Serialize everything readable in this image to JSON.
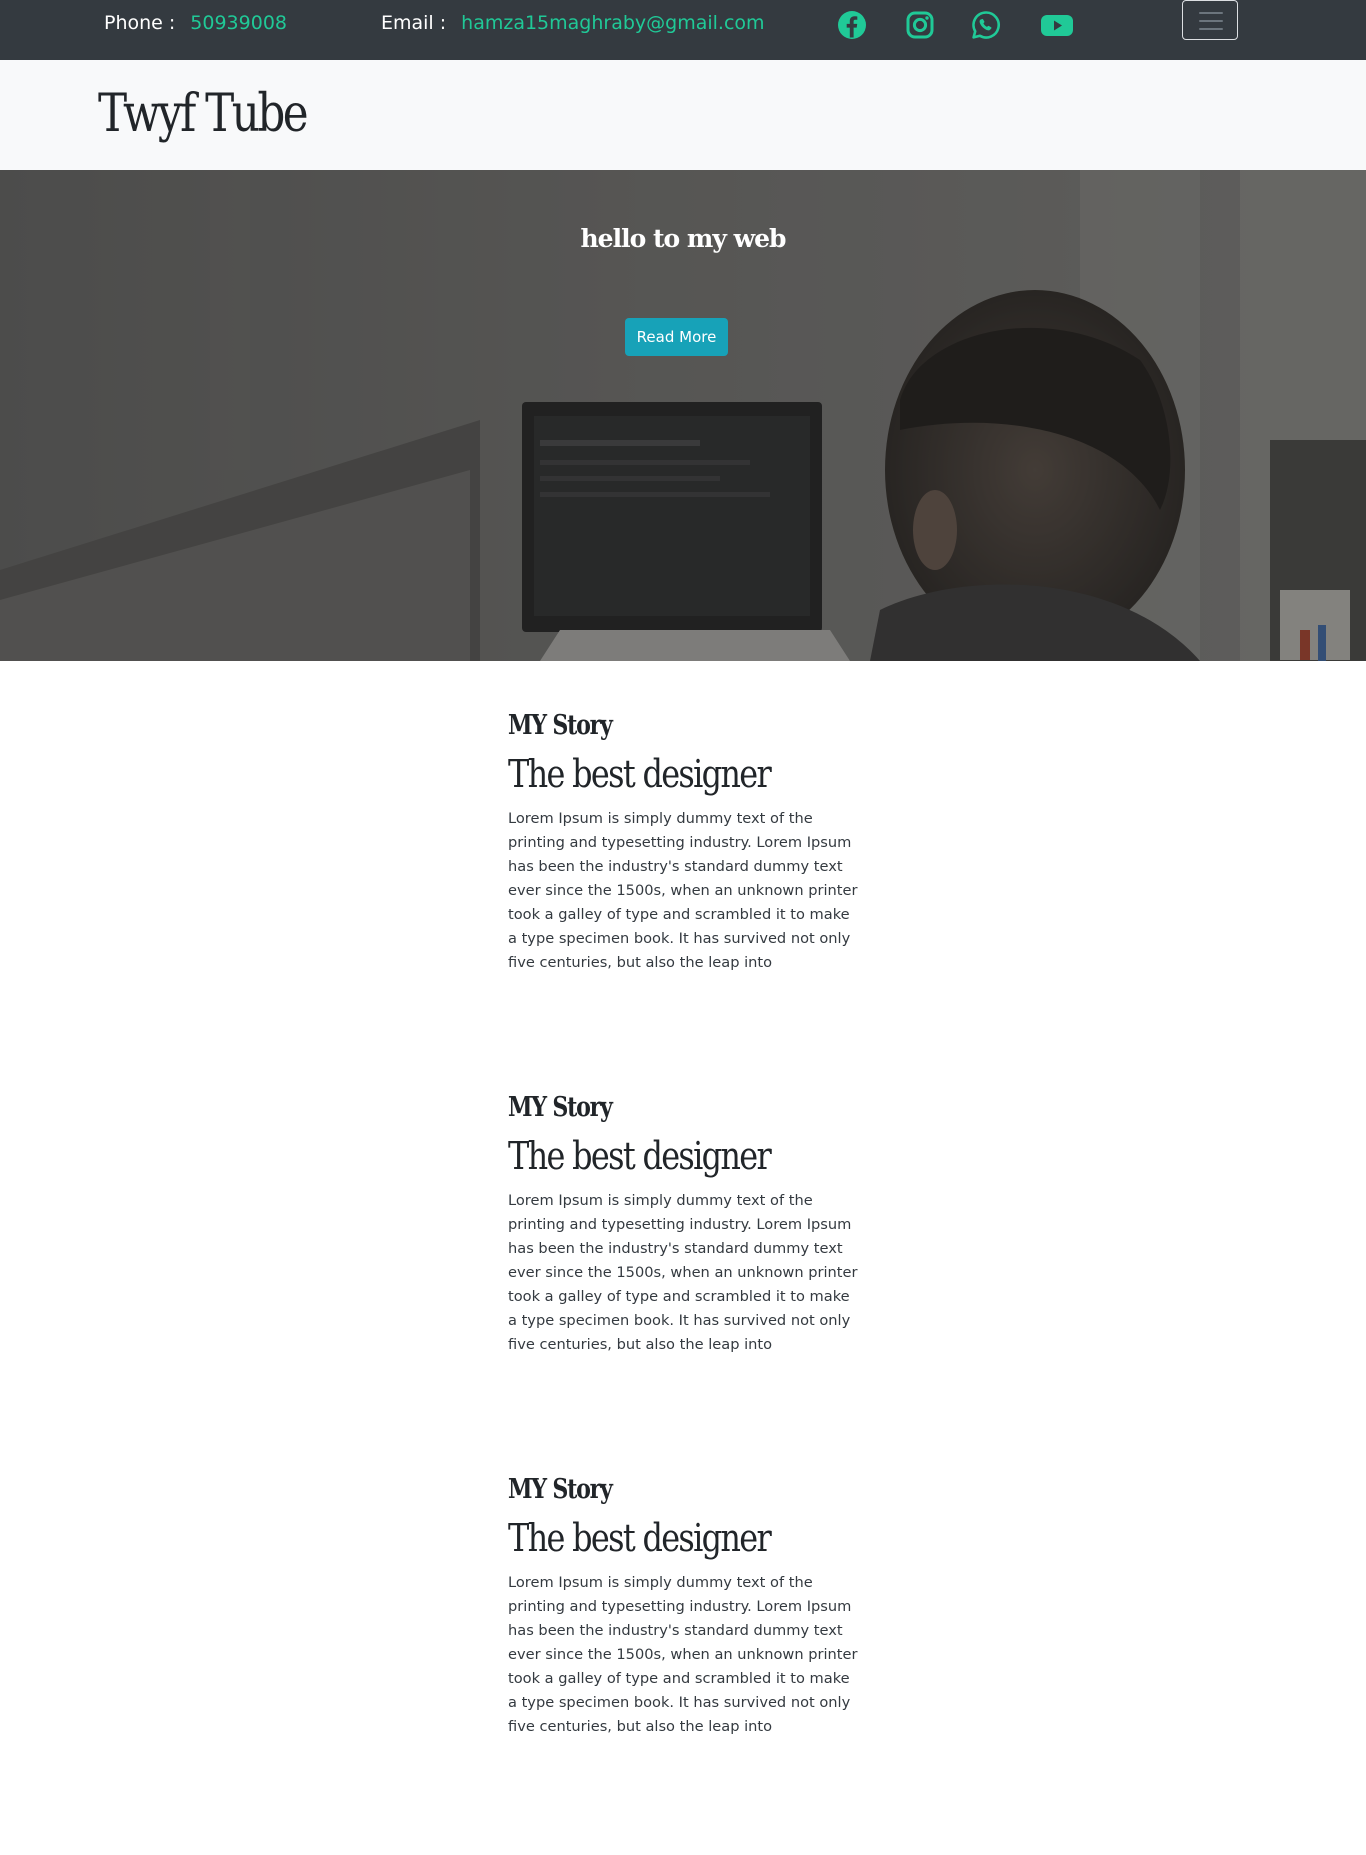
{
  "topbar": {
    "phone_label": "Phone :",
    "phone_value": "50939008",
    "email_label": "Email :",
    "email_value": "hamza15maghraby@gmail.com",
    "social": [
      {
        "icon": "facebook-icon"
      },
      {
        "icon": "instagram-icon"
      },
      {
        "icon": "whatsapp-icon"
      },
      {
        "icon": "youtube-icon"
      }
    ],
    "accent_color": "#20c997",
    "background_color": "#343a40"
  },
  "navbar": {
    "brand": "Twyf Tube",
    "toggler_icon": "hamburger-menu-icon"
  },
  "hero": {
    "title": "hello to my web",
    "button_label": "Read More",
    "button_color": "#17a2b8"
  },
  "stories": [
    {
      "eyebrow": "MY Story",
      "title": "The best designer",
      "text": "Lorem Ipsum is simply dummy text of the printing and typesetting industry. Lorem Ipsum has been the industry's standard dummy text ever since the 1500s, when an unknown printer took a galley of type and scrambled it to make a type specimen book. It has survived not only five centuries, but also the leap into"
    },
    {
      "eyebrow": "MY Story",
      "title": "The best designer",
      "text": "Lorem Ipsum is simply dummy text of the printing and typesetting industry. Lorem Ipsum has been the industry's standard dummy text ever since the 1500s, when an unknown printer took a galley of type and scrambled it to make a type specimen book. It has survived not only five centuries, but also the leap into"
    },
    {
      "eyebrow": "MY Story",
      "title": "The best designer",
      "text": "Lorem Ipsum is simply dummy text of the printing and typesetting industry. Lorem Ipsum has been the industry's standard dummy text ever since the 1500s, when an unknown printer took a galley of type and scrambled it to make a type specimen book. It has survived not only five centuries, but also the leap into"
    }
  ]
}
